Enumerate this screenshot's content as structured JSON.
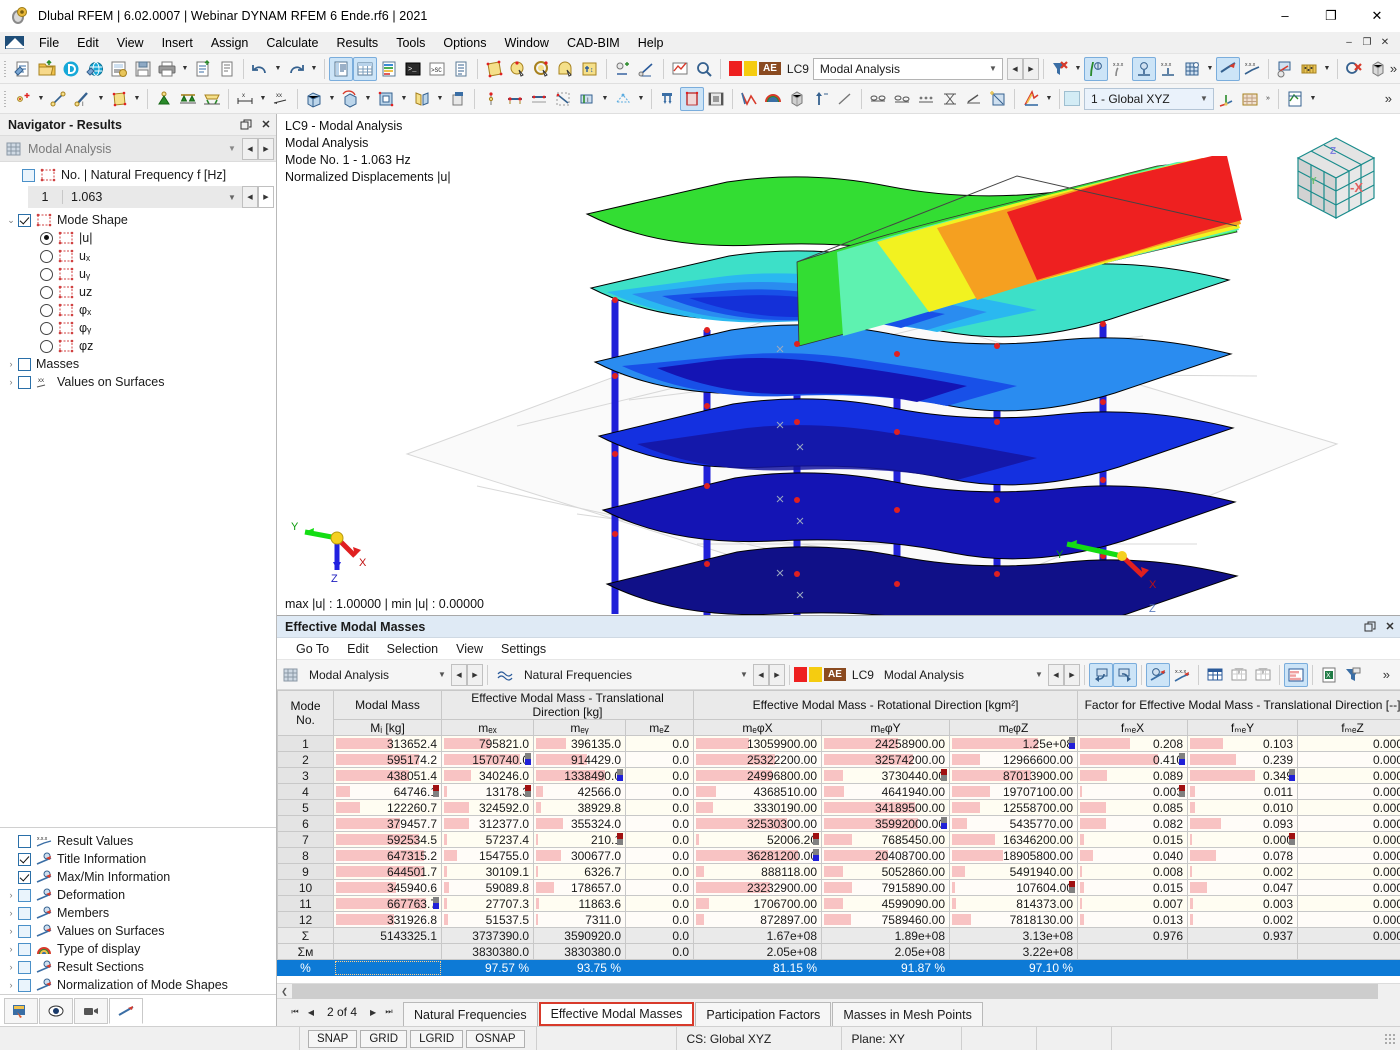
{
  "window": {
    "title": "Dlubal RFEM | 6.02.0007 | Webinar DYNAM RFEM 6 Ende.rf6 | 2021",
    "minimize": "–",
    "maximize": "❐",
    "close": "✕"
  },
  "menubar": {
    "items": [
      "File",
      "Edit",
      "View",
      "Insert",
      "Assign",
      "Calculate",
      "Results",
      "Tools",
      "Options",
      "Window",
      "CAD-BIM",
      "Help"
    ],
    "mdi_minimize": "–",
    "mdi_restore": "❐",
    "mdi_close": "✕"
  },
  "toolbar_main": {
    "load_case_id": "LC9",
    "load_case_tag": "AE",
    "load_case_name": "Modal Analysis",
    "swatch_red": "#ee2020",
    "swatch_yellow": "#f5cc10",
    "tag_bg": "#8a4a20",
    "overflow": "»"
  },
  "toolbar_second": {
    "coordinate_system": "1 - Global XYZ",
    "overflow": "»"
  },
  "navigator": {
    "header": "Navigator - Results",
    "analysis_combo": "Modal Analysis",
    "tree": {
      "natural_frequency_label": "No. | Natural Frequency f [Hz]",
      "frequency_no": "1",
      "frequency_value": "1.063",
      "mode_shape_label": "Mode Shape",
      "components": [
        "|u|",
        "uₓ",
        "uᵧ",
        "uᴢ",
        "φₓ",
        "φᵧ",
        "φᴢ"
      ],
      "selected_component": "|u|",
      "masses_label": "Masses",
      "values_on_surfaces_label": "Values on Surfaces"
    },
    "display_items": [
      {
        "label": "Result Values",
        "checked": false,
        "expandable": false,
        "icon": "result-values-icon"
      },
      {
        "label": "Title Information",
        "checked": true,
        "expandable": false,
        "icon": "title-info-icon"
      },
      {
        "label": "Max/Min Information",
        "checked": true,
        "expandable": false,
        "icon": "maxmin-info-icon"
      },
      {
        "label": "Deformation",
        "checked": false,
        "expandable": true,
        "icon": "deformation-icon"
      },
      {
        "label": "Members",
        "checked": false,
        "expandable": true,
        "icon": "members-icon"
      },
      {
        "label": "Values on Surfaces",
        "checked": false,
        "expandable": true,
        "icon": "surfaces-icon"
      },
      {
        "label": "Type of display",
        "checked": false,
        "expandable": true,
        "icon": "type-of-display-icon"
      },
      {
        "label": "Result Sections",
        "checked": false,
        "expandable": true,
        "icon": "result-sections-icon"
      },
      {
        "label": "Normalization of Mode Shapes",
        "checked": false,
        "expandable": true,
        "icon": "normalization-icon"
      }
    ]
  },
  "viewport": {
    "title_lines": "LC9 - Modal Analysis\nModal Analysis\nMode No. 1 - 1.063 Hz\nNormalized Displacements |u|",
    "minmax": "max |u| : 1.00000 | min |u| : 0.00000",
    "axis_x": "X",
    "axis_y": "Y",
    "axis_z": "Z",
    "cube_face": "-X",
    "cube_label_z": "Z",
    "cube_label_y": "Y"
  },
  "results_panel": {
    "title": "Effective Modal Masses",
    "menu": [
      "Go To",
      "Edit",
      "Selection",
      "View",
      "Settings"
    ],
    "analysis_combo": "Modal Analysis",
    "table_combo": "Natural Frequencies",
    "load_case_id": "LC9",
    "load_case_tag": "AE",
    "load_case_name": "Modal Analysis",
    "overflow": "»"
  },
  "table": {
    "group_headers": [
      {
        "label": "Mode",
        "sub": "No."
      },
      {
        "label": "Modal Mass",
        "sub": "Mᵢ [kg]"
      },
      {
        "label": "Effective Modal Mass - Translational Direction [kg]",
        "subs": [
          "mₑₓ",
          "mₑᵧ",
          "mₑᴢ"
        ]
      },
      {
        "label": "Effective Modal Mass - Rotational Direction [kgm²]",
        "subs": [
          "mₑφX",
          "mₑφY",
          "mₑφZ"
        ]
      },
      {
        "label": "Factor for Effective Modal Mass - Translational Direction [--]",
        "subs": [
          "fₘₑX",
          "fₘₑY",
          "fₘₑZ"
        ]
      }
    ],
    "rows": [
      {
        "mode": "1",
        "mi": "313652.4",
        "mex": "795821.0",
        "mey": "396135.0",
        "mez": "0.0",
        "mphx": "13059900.00",
        "mphy": "24258900.00",
        "mphz": "1.25e+08",
        "fmex": "0.208",
        "fmey": "0.103",
        "fmez": "0.000",
        "bars": {
          "mi": 52,
          "mex": 50,
          "mey": 33,
          "mphx": 42,
          "mphy": 58,
          "mphz": 68,
          "fmex": 46,
          "fmey": 30
        },
        "flags": {
          "mphz": "blue",
          "fmex": "",
          "fmey": ""
        }
      },
      {
        "mode": "2",
        "mi": "595174.2",
        "mex": "1570740.0",
        "mey": "914429.0",
        "mez": "0.0",
        "mphx": "25322200.00",
        "mphy": "32574200.00",
        "mphz": "12966600.00",
        "fmex": "0.410",
        "fmey": "0.239",
        "fmez": "0.000",
        "bars": {
          "mi": 78,
          "mex": 83,
          "mey": 56,
          "mphx": 62,
          "mphy": 70,
          "mphz": 22,
          "fmex": 72,
          "fmey": 42
        },
        "flags": {
          "mex": "blue",
          "fmex": "blue"
        }
      },
      {
        "mode": "3",
        "mi": "438051.4",
        "mex": "340246.0",
        "mey": "1338490.0",
        "mez": "0.0",
        "mphx": "24996800.00",
        "mphy": "3730440.00",
        "mphz": "87013900.00",
        "fmex": "0.089",
        "fmey": "0.349",
        "fmez": "0.000",
        "bars": {
          "mi": 68,
          "mex": 30,
          "mey": 76,
          "mphx": 60,
          "mphy": 15,
          "mphz": 62,
          "fmex": 25,
          "fmey": 60
        },
        "flags": {
          "mey": "blue",
          "mphy": "red",
          "fmey": "blue"
        }
      },
      {
        "mode": "4",
        "mi": "64746.1",
        "mex": "13178.3",
        "mey": "42566.0",
        "mez": "0.0",
        "mphx": "4368510.00",
        "mphy": "4641940.00",
        "mphz": "19707100.00",
        "fmex": "0.003",
        "fmey": "0.011",
        "fmez": "0.000",
        "bars": {
          "mi": 13,
          "mex": 3,
          "mey": 8,
          "mphx": 16,
          "mphy": 16,
          "mphz": 30,
          "fmex": 2,
          "fmey": 5
        },
        "flags": {
          "mi": "red",
          "mex": "red",
          "fmex": "red"
        }
      },
      {
        "mode": "5",
        "mi": "122260.7",
        "mex": "324592.0",
        "mey": "38929.8",
        "mez": "0.0",
        "mphx": "3330190.00",
        "mphy": "34189500.00",
        "mphz": "12558700.00",
        "fmex": "0.085",
        "fmey": "0.010",
        "fmez": "0.000",
        "bars": {
          "mi": 22,
          "mex": 28,
          "mey": 5,
          "mphx": 13,
          "mphy": 72,
          "mphz": 22,
          "fmex": 24,
          "fmey": 5
        },
        "flags": {}
      },
      {
        "mode": "6",
        "mi": "379457.7",
        "mex": "312377.0",
        "mey": "355324.0",
        "mez": "0.0",
        "mphx": "32530300.00",
        "mphy": "35992000.00",
        "mphz": "5435770.00",
        "fmex": "0.082",
        "fmey": "0.093",
        "fmez": "0.000",
        "bars": {
          "mi": 60,
          "mex": 28,
          "mey": 30,
          "mphx": 72,
          "mphy": 74,
          "mphz": 12,
          "fmex": 24,
          "fmey": 28
        },
        "flags": {
          "mphy": "blue"
        }
      },
      {
        "mode": "7",
        "mi": "592534.5",
        "mex": "57237.4",
        "mey": "210.1",
        "mez": "0.0",
        "mphx": "52006.20",
        "mphy": "7685450.00",
        "mphz": "16346200.00",
        "fmex": "0.015",
        "fmey": "0.000",
        "fmez": "0.000",
        "bars": {
          "mi": 78,
          "mex": 3,
          "mey": 2,
          "mphx": 2,
          "mphy": 22,
          "mphz": 34,
          "fmex": 4,
          "fmey": 2
        },
        "flags": {
          "mey": "red",
          "mphx": "red",
          "fmey": "red"
        }
      },
      {
        "mode": "8",
        "mi": "647315.2",
        "mex": "154755.0",
        "mey": "300677.0",
        "mez": "0.0",
        "mphx": "36281200.00",
        "mphy": "20408700.00",
        "mphz": "18905800.00",
        "fmex": "0.040",
        "fmey": "0.078",
        "fmez": "0.000",
        "bars": {
          "mi": 82,
          "mex": 14,
          "mey": 28,
          "mphx": 80,
          "mphy": 50,
          "mphz": 40,
          "fmex": 12,
          "fmey": 24
        },
        "flags": {
          "mphx": "blue"
        }
      },
      {
        "mode": "9",
        "mi": "644501.7",
        "mex": "30109.1",
        "mey": "6326.7",
        "mez": "0.0",
        "mphx": "888118.00",
        "mphy": "5052860.00",
        "mphz": "5491940.00",
        "fmex": "0.008",
        "fmey": "0.002",
        "fmez": "0.000",
        "bars": {
          "mi": 82,
          "mex": 3,
          "mey": 2,
          "mphx": 6,
          "mphy": 15,
          "mphz": 10,
          "fmex": 2,
          "fmey": 2
        },
        "flags": {}
      },
      {
        "mode": "10",
        "mi": "345940.6",
        "mex": "59089.8",
        "mey": "178657.0",
        "mez": "0.0",
        "mphx": "23232900.00",
        "mphy": "7915890.00",
        "mphz": "107604.00",
        "fmex": "0.015",
        "fmey": "0.047",
        "fmez": "0.000",
        "bars": {
          "mi": 56,
          "mex": 5,
          "mey": 20,
          "mphx": 58,
          "mphy": 22,
          "mphz": 2,
          "fmex": 4,
          "fmey": 16
        },
        "flags": {
          "mphz": "red"
        }
      },
      {
        "mode": "11",
        "mi": "667763.7",
        "mex": "27707.3",
        "mey": "11863.6",
        "mez": "0.0",
        "mphx": "1706700.00",
        "mphy": "4599090.00",
        "mphz": "814373.00",
        "fmex": "0.007",
        "fmey": "0.003",
        "fmez": "0.000",
        "bars": {
          "mi": 84,
          "mex": 3,
          "mey": 3,
          "mphx": 10,
          "mphy": 15,
          "mphz": 3,
          "fmex": 2,
          "fmey": 3
        },
        "flags": {
          "mi": "blue"
        }
      },
      {
        "mode": "12",
        "mi": "331926.8",
        "mex": "51537.5",
        "mey": "7311.0",
        "mez": "0.0",
        "mphx": "872897.00",
        "mphy": "7589460.00",
        "mphz": "7818130.00",
        "fmex": "0.013",
        "fmey": "0.002",
        "fmez": "0.000",
        "bars": {
          "mi": 54,
          "mex": 4,
          "mey": 2,
          "mphx": 6,
          "mphy": 21,
          "mphz": 15,
          "fmex": 4,
          "fmey": 3
        },
        "flags": {}
      }
    ],
    "sum_row": {
      "mode": "Σ",
      "mi": "5143325.1",
      "mex": "3737390.0",
      "mey": "3590920.0",
      "mez": "0.0",
      "mphx": "1.67e+08",
      "mphy": "1.89e+08",
      "mphz": "3.13e+08",
      "fmex": "0.976",
      "fmey": "0.937",
      "fmez": "0.000"
    },
    "summ_row": {
      "mode": "Σᴍ",
      "mi": "",
      "mex": "3830380.0",
      "mey": "3830380.0",
      "mez": "0.0",
      "mphx": "2.05e+08",
      "mphy": "2.05e+08",
      "mphz": "3.22e+08",
      "fmex": "",
      "fmey": "",
      "fmez": ""
    },
    "pct_row": {
      "mode": "%",
      "mi": "",
      "mex": "97.57 %",
      "mey": "93.75 %",
      "mez": "",
      "mphx": "81.15 %",
      "mphy": "91.87 %",
      "mphz": "97.10 %",
      "fmex": "",
      "fmey": "",
      "fmez": ""
    }
  },
  "bottom_tabs": {
    "page_indicator": "2 of 4",
    "first": "⏮",
    "prev": "◀",
    "next": "▶",
    "last": "⏭",
    "tabs": [
      "Natural Frequencies",
      "Effective Modal Masses",
      "Participation Factors",
      "Masses in Mesh Points"
    ],
    "selected": "Effective Modal Masses"
  },
  "statusbar": {
    "chips": [
      "SNAP",
      "GRID",
      "LGRID",
      "OSNAP"
    ],
    "cs": "CS: Global XYZ",
    "plane": "Plane: XY"
  },
  "colors": {
    "accent_blue": "#0d7ad6",
    "bar_pink": "#f8c3c3",
    "tab_red": "#d83a2b",
    "title_panel": "#dfeaf5"
  }
}
